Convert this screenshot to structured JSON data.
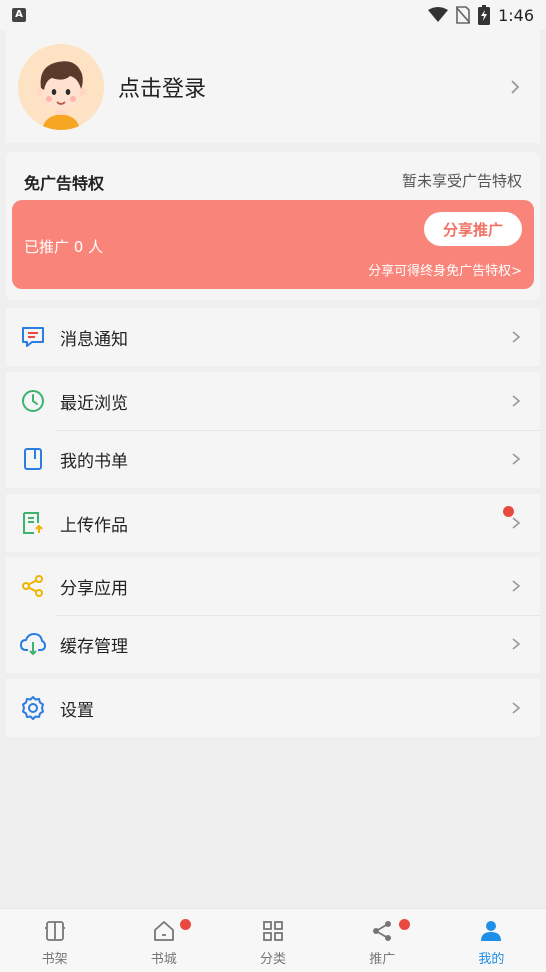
{
  "status_bar": {
    "left_badge": "A",
    "time": "1:46",
    "icons": [
      "wifi-icon",
      "no-sim-icon",
      "battery-charging-icon"
    ]
  },
  "profile": {
    "login_text": "点击登录",
    "avatar": "boy-avatar"
  },
  "ad_free": {
    "title": "免广告特权",
    "status": "暂未享受广告特权",
    "promoted_count": "已推广 0 人",
    "share_button": "分享推广",
    "hint": "分享可得终身免广告特权>",
    "banner_color": "#f9857a"
  },
  "menu": {
    "messages": {
      "label": "消息通知",
      "icon": "message-icon",
      "color": "#2a7de1"
    },
    "recent": {
      "label": "最近浏览",
      "icon": "clock-icon",
      "color": "#3cb371"
    },
    "booklist": {
      "label": "我的书单",
      "icon": "bookmark-icon",
      "color": "#2a7de1"
    },
    "upload": {
      "label": "上传作品",
      "icon": "upload-doc-icon",
      "color": "#3cb371",
      "has_badge": true
    },
    "share_app": {
      "label": "分享应用",
      "icon": "share-icon",
      "color": "#f0b400"
    },
    "cache": {
      "label": "缓存管理",
      "icon": "cloud-download-icon",
      "color": "#2a7de1"
    },
    "settings": {
      "label": "设置",
      "icon": "gear-icon",
      "color": "#2a7de1"
    }
  },
  "bottom_nav": {
    "items": [
      {
        "label": "书架",
        "icon": "bookshelf-icon",
        "active": false,
        "badge": false
      },
      {
        "label": "书城",
        "icon": "home-icon",
        "active": false,
        "badge": true
      },
      {
        "label": "分类",
        "icon": "category-icon",
        "active": false,
        "badge": false
      },
      {
        "label": "推广",
        "icon": "share-icon",
        "active": false,
        "badge": true
      },
      {
        "label": "我的",
        "icon": "person-icon",
        "active": true,
        "badge": false
      }
    ],
    "active_color": "#1e8fe6"
  }
}
